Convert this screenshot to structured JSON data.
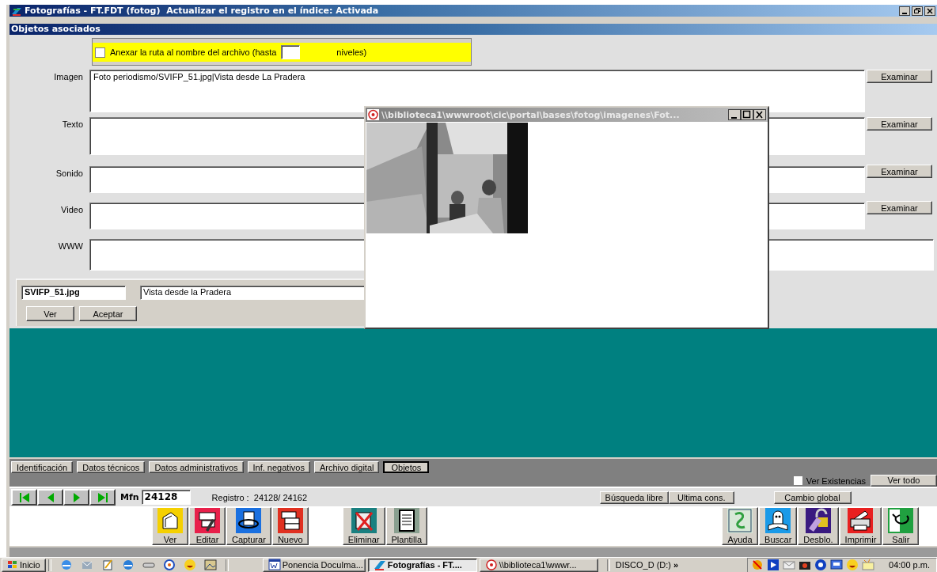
{
  "window": {
    "title": "Fotografías - FT.FDT (fotog)  Actualizar el registro en el índice: Activada"
  },
  "panel": {
    "title": "Objetos asociados"
  },
  "path_option": {
    "label": "Anexar la ruta al nombre del archivo (hasta",
    "checked": false,
    "suffix": "niveles)"
  },
  "fields": [
    {
      "label": "Imagen",
      "value": "Foto periodismo/SVIFP_51.jpg|Vista desde La Pradera",
      "button": "Examinar"
    },
    {
      "label": "Texto",
      "button": "Examinar"
    },
    {
      "label": "Sonido",
      "button": "Examinar"
    },
    {
      "label": "Video",
      "button": "Examinar"
    },
    {
      "label": "WWW"
    }
  ],
  "file_entry": {
    "filename": "SVIFP_51.jpg",
    "description": "Vista desde la Pradera",
    "buttons": [
      "Ver",
      "Aceptar"
    ]
  },
  "viewer": {
    "title": "\\\\biblioteca1\\wwwroot\\cic\\portal\\bases\\fotog\\imagenes\\Fot..."
  },
  "tabs": [
    {
      "label": "Identificación",
      "selected": false
    },
    {
      "label": "Datos técnicos",
      "selected": false
    },
    {
      "label": "Datos administrativos",
      "selected": false
    },
    {
      "label": "Inf. negativos",
      "selected": false
    },
    {
      "label": "Archivo digital",
      "selected": false
    },
    {
      "label": "Objetos",
      "selected": true
    }
  ],
  "ver_existencias": {
    "label": "Ver Existencias",
    "checked": false
  },
  "ver_todo": "Ver todo",
  "nav": {
    "mfn_label": "Mfn",
    "mfn": "24128",
    "registro": "Registro :  24128/ 24162"
  },
  "search_buttons": [
    "Búsqueda libre",
    "Ultima cons."
  ],
  "cambio_global": "Cambio global",
  "toolbar_left": [
    {
      "label": "Ver",
      "kind": "ver"
    },
    {
      "label": "Editar",
      "kind": "editar"
    },
    {
      "label": "Capturar",
      "kind": "capturar"
    },
    {
      "label": "Nuevo",
      "kind": "nuevo"
    },
    {
      "label": "Eliminar",
      "kind": "eliminar"
    },
    {
      "label": "Plantilla",
      "kind": "plantilla"
    }
  ],
  "toolbar_right": [
    {
      "label": "Ayuda",
      "kind": "ayuda"
    },
    {
      "label": "Buscar",
      "kind": "buscar"
    },
    {
      "label": "Desblo.",
      "kind": "desblo"
    },
    {
      "label": "Imprimir",
      "kind": "imprimir"
    },
    {
      "label": "Salir",
      "kind": "salir"
    }
  ],
  "taskbar": {
    "start": "Inicio",
    "tasks": [
      {
        "label": "Ponencia DocuIma...",
        "kind": "word",
        "selected": false
      },
      {
        "label": "Fotografías - FT....",
        "kind": "app",
        "selected": true
      },
      {
        "label": "\\\\biblioteca1\\wwwr...",
        "kind": "viewer",
        "selected": false
      }
    ],
    "drive": "DISCO_D (D:)",
    "chevron": "»",
    "clock": "04:00 p.m."
  }
}
